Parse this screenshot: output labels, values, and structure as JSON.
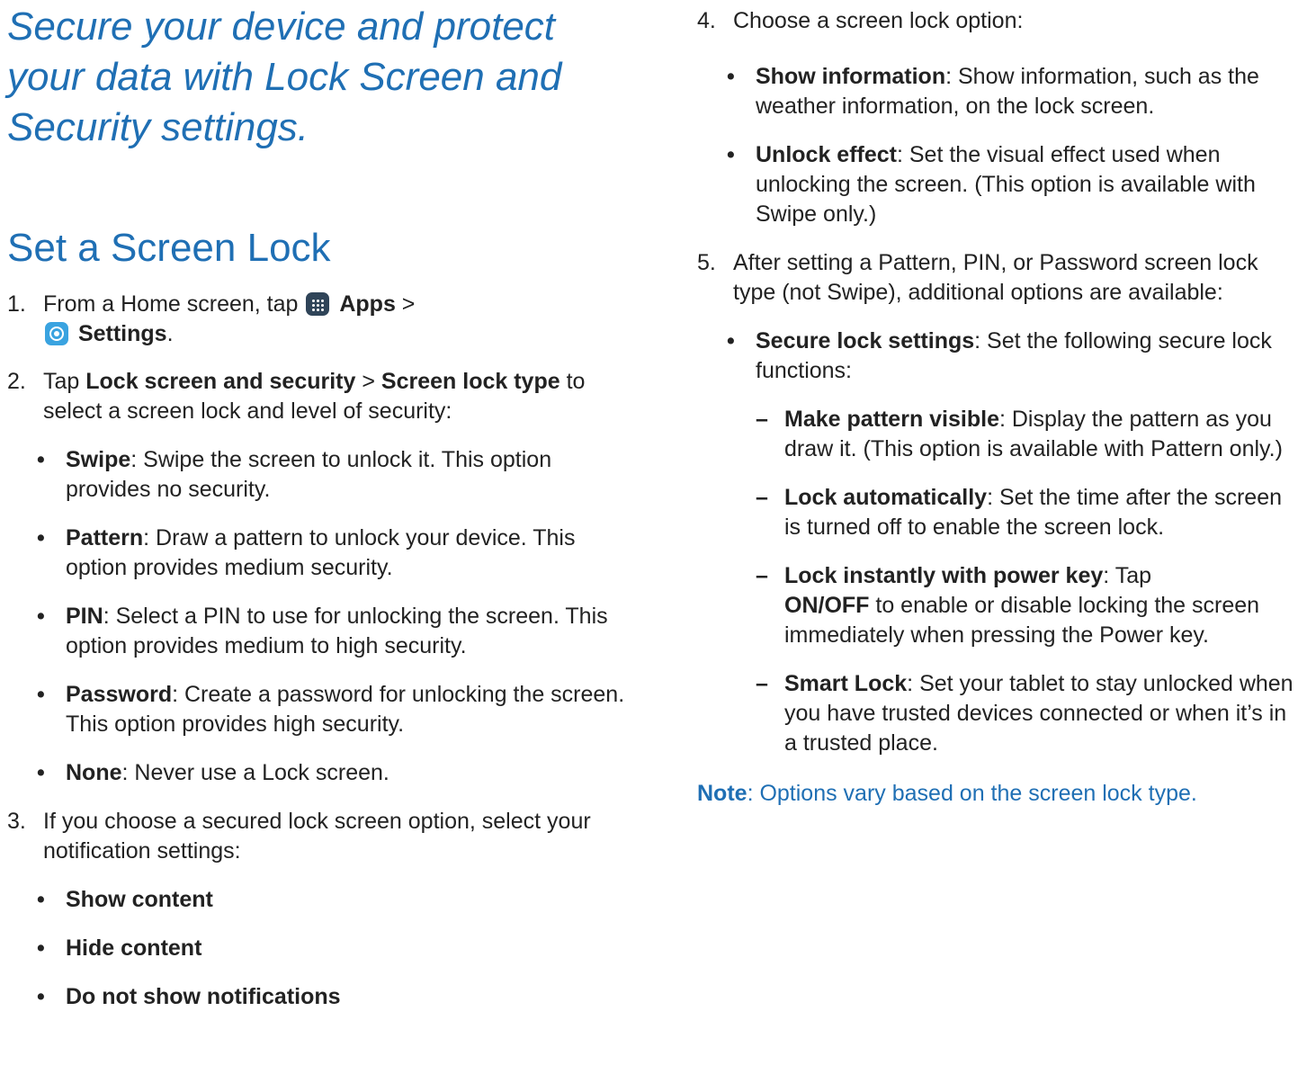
{
  "left": {
    "intro": "Secure your device and protect your data with Lock Screen and Security settings.",
    "section_title": "Set a Screen Lock",
    "step1": {
      "num": "1.",
      "prefix": "From a Home screen, tap",
      "apps": "Apps",
      "sep": ">",
      "settings": "Settings",
      "end": ".",
      "apps_icon": "apps-grid-icon",
      "settings_icon": "gear-icon"
    },
    "step2": {
      "num": "2.",
      "prefix": "Tap",
      "b1": "Lock screen and security",
      "sep": ">",
      "b2": "Screen lock type",
      "rest": "to select a screen lock and level of security:",
      "items": [
        {
          "bold": "Swipe",
          "text": ": Swipe the screen to unlock it. This option provides no security."
        },
        {
          "bold": "Pattern",
          "text": ": Draw a pattern to unlock your device. This option provides medium security."
        },
        {
          "bold": "PIN",
          "text": ": Select a PIN to use for unlocking the screen. This option provides medium to high security."
        },
        {
          "bold": "Password",
          "text": ": Create a password for unlocking the screen. This option provides high security."
        },
        {
          "bold": "None",
          "text": ": Never use a Lock screen."
        }
      ]
    },
    "step3": {
      "num": "3.",
      "text": "If you choose a secured lock screen option, select your notification settings:",
      "items": [
        "Show content",
        "Hide content",
        "Do not show notifications"
      ]
    }
  },
  "right": {
    "step4": {
      "num": "4.",
      "text": "Choose a screen lock option:",
      "items": [
        {
          "bold": "Show information",
          "text": ": Show information, such as the weather information, on the lock screen."
        },
        {
          "bold": "Unlock effect",
          "text": ": Set the visual effect used when unlocking the screen. (This option is available with Swipe only.)"
        }
      ]
    },
    "step5": {
      "num": "5.",
      "text": "After setting a Pattern, PIN, or Password screen lock type (not Swipe), additional options are available:",
      "item": {
        "bold": "Secure lock settings",
        "text": ": Set the following secure lock functions:"
      },
      "subitems": [
        {
          "bold": "Make pattern visible",
          "text": ": Display the pattern as you draw it. (This option is available with Pattern only.)"
        },
        {
          "bold": "Lock automatically",
          "text": ": Set the time after the screen is turned off to enable the screen lock."
        },
        {
          "bold": "Lock instantly with power key",
          "text": ": Tap",
          "bold2": "ON/OFF",
          "text2": "to enable or disable locking the screen immediately when pressing the Power key."
        },
        {
          "bold": "Smart Lock",
          "text": ": Set your tablet to stay unlocked when you have trusted devices connected or when it’s in a trusted place."
        }
      ]
    },
    "note": {
      "bold": "Note",
      "text": ": Options vary based on the screen lock type."
    }
  },
  "bullet": "•",
  "dash": "–",
  "colors": {
    "accent": "#1f6fb4",
    "text": "#222222"
  }
}
